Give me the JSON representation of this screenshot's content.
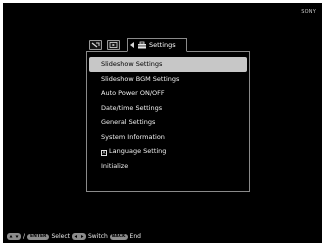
{
  "header": {
    "brand_text": "SONY"
  },
  "tabs": {
    "active_label": "Settings"
  },
  "menu": {
    "items": [
      {
        "label": "Slideshow Settings",
        "selected": true
      },
      {
        "label": "Slideshow BGM Settings",
        "selected": false
      },
      {
        "label": "Auto Power ON/OFF",
        "selected": false
      },
      {
        "label": "Date/time Settings",
        "selected": false
      },
      {
        "label": "General Settings",
        "selected": false
      },
      {
        "label": "System Information",
        "selected": false
      },
      {
        "label": "Language Setting",
        "selected": false
      },
      {
        "label": "Initialize",
        "selected": false
      }
    ],
    "language_glyph": "A"
  },
  "footer": {
    "separator": "/",
    "enter_key": "ENTER",
    "select_label": "Select",
    "switch_label": "Switch",
    "back_key": "BACK",
    "end_label": "End"
  },
  "colors": {
    "background": "#000000",
    "selected_row": "#c7c7c7",
    "text": "#f2f2f2",
    "key_fill": "#8c8c8c"
  }
}
